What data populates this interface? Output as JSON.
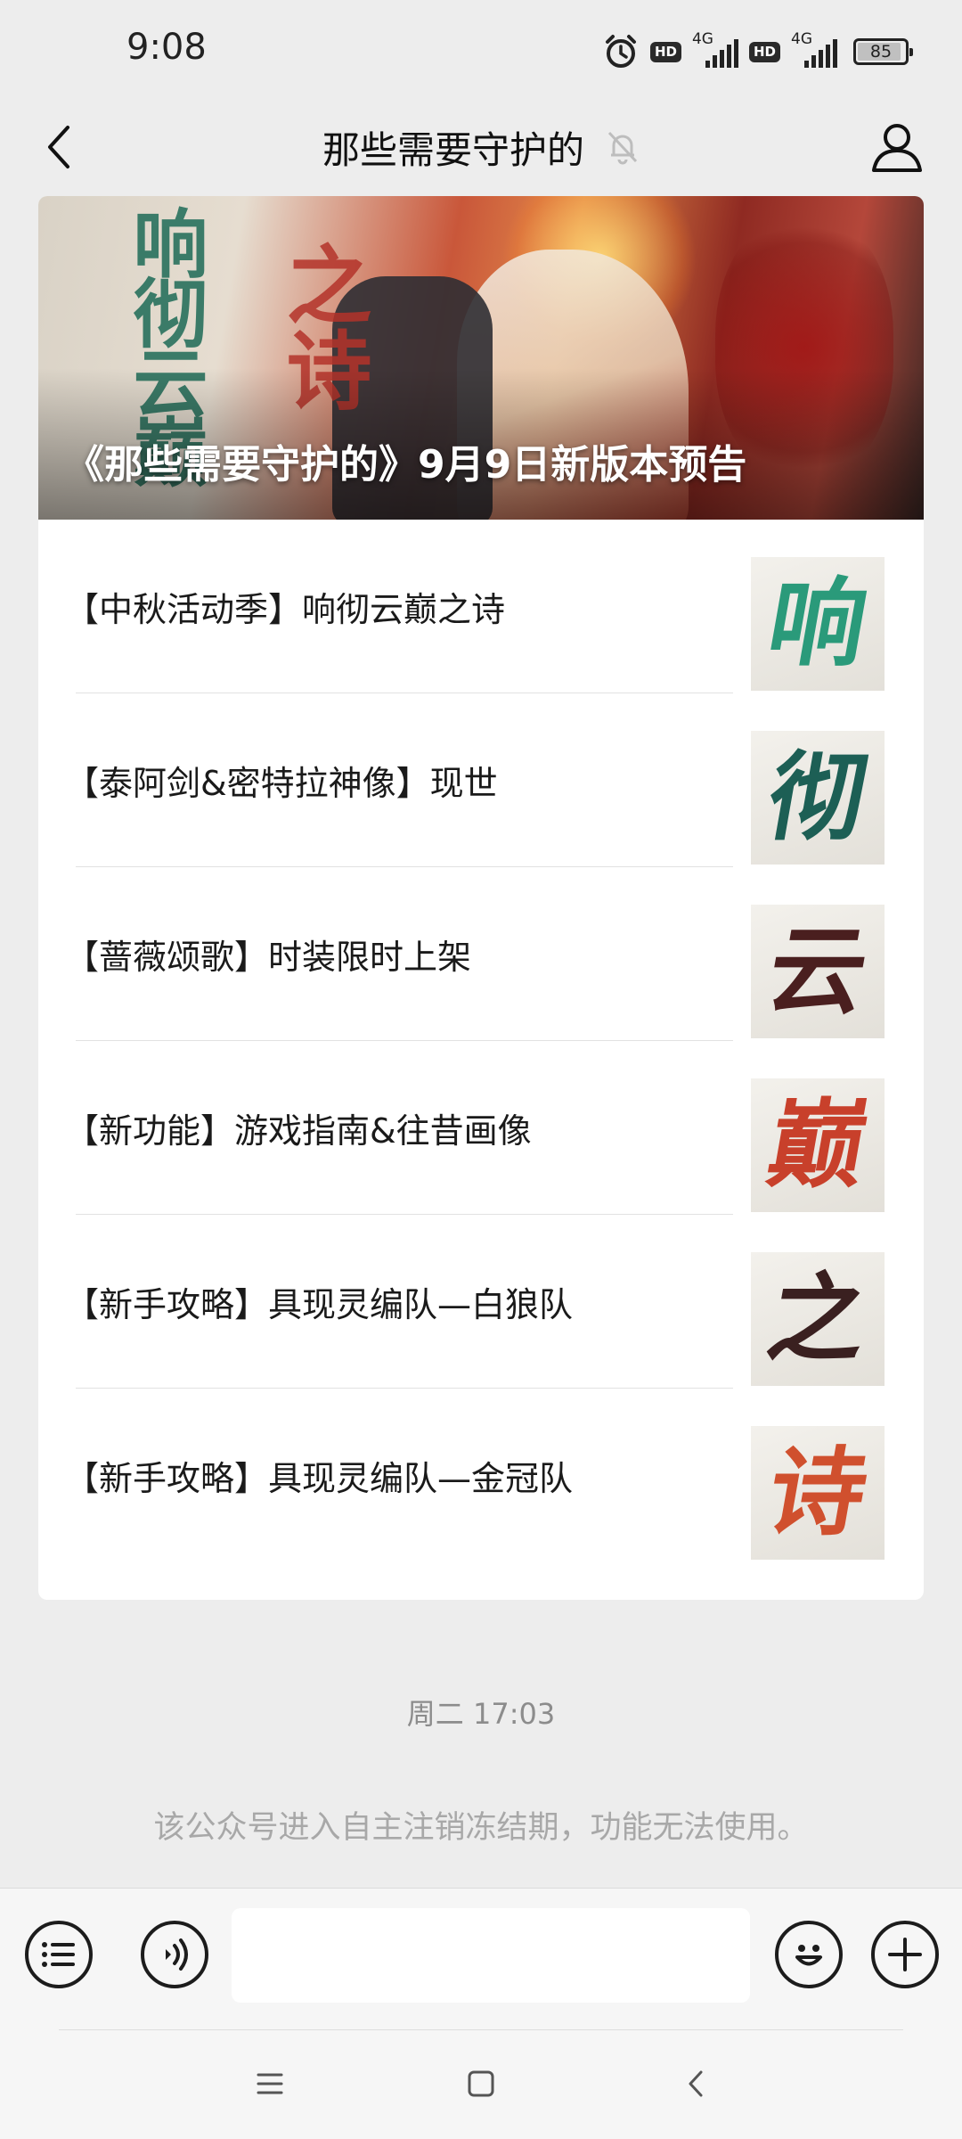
{
  "status_bar": {
    "time": "9:08",
    "hd1": "HD",
    "net1": "4G",
    "hd2": "HD",
    "net2": "4G",
    "battery": "85",
    "battery_level_percent": 85,
    "icons": [
      "alarm-icon",
      "signal-icon",
      "battery-icon"
    ]
  },
  "nav": {
    "title": "那些需要守护的",
    "icons": [
      "back-arrow-icon",
      "mute-bell-icon",
      "profile-icon"
    ]
  },
  "article_card": {
    "cover": {
      "title": "《那些需要守护的》9月9日新版本预告",
      "calligraphy_left": "响彻云巅",
      "calligraphy_right": "之诗"
    },
    "items": [
      {
        "title": "【中秋活动季】响彻云巅之诗",
        "thumb_char": "响",
        "thumb_color": "#2a9a7a"
      },
      {
        "title": "【泰阿剑&密特拉神像】现世",
        "thumb_char": "彻",
        "thumb_color": "#1d5f55"
      },
      {
        "title": "【蔷薇颂歌】时装限时上架",
        "thumb_char": "云",
        "thumb_color": "#4a1f1f"
      },
      {
        "title": "【新功能】游戏指南&往昔画像",
        "thumb_char": "巅",
        "thumb_color": "#c8402b"
      },
      {
        "title": "【新手攻略】具现灵编队—白狼队",
        "thumb_char": "之",
        "thumb_color": "#3a2020"
      },
      {
        "title": "【新手攻略】具现灵编队—金冠队",
        "thumb_char": "诗",
        "thumb_color": "#d0502e"
      }
    ]
  },
  "timestamp": "周二 17:03",
  "notice": "该公众号进入自主注销冻结期，功能无法使用。",
  "input_bar": {
    "icons": [
      "menu-list-icon",
      "voice-icon",
      "emoji-icon",
      "plus-icon"
    ],
    "text_value": ""
  },
  "system_nav": {
    "icons": [
      "recent-apps-icon",
      "home-icon",
      "back-icon"
    ]
  },
  "colors": {
    "background": "#ededed",
    "card": "#ffffff",
    "text": "#1a1a1a",
    "muted": "#a8a8a8"
  }
}
